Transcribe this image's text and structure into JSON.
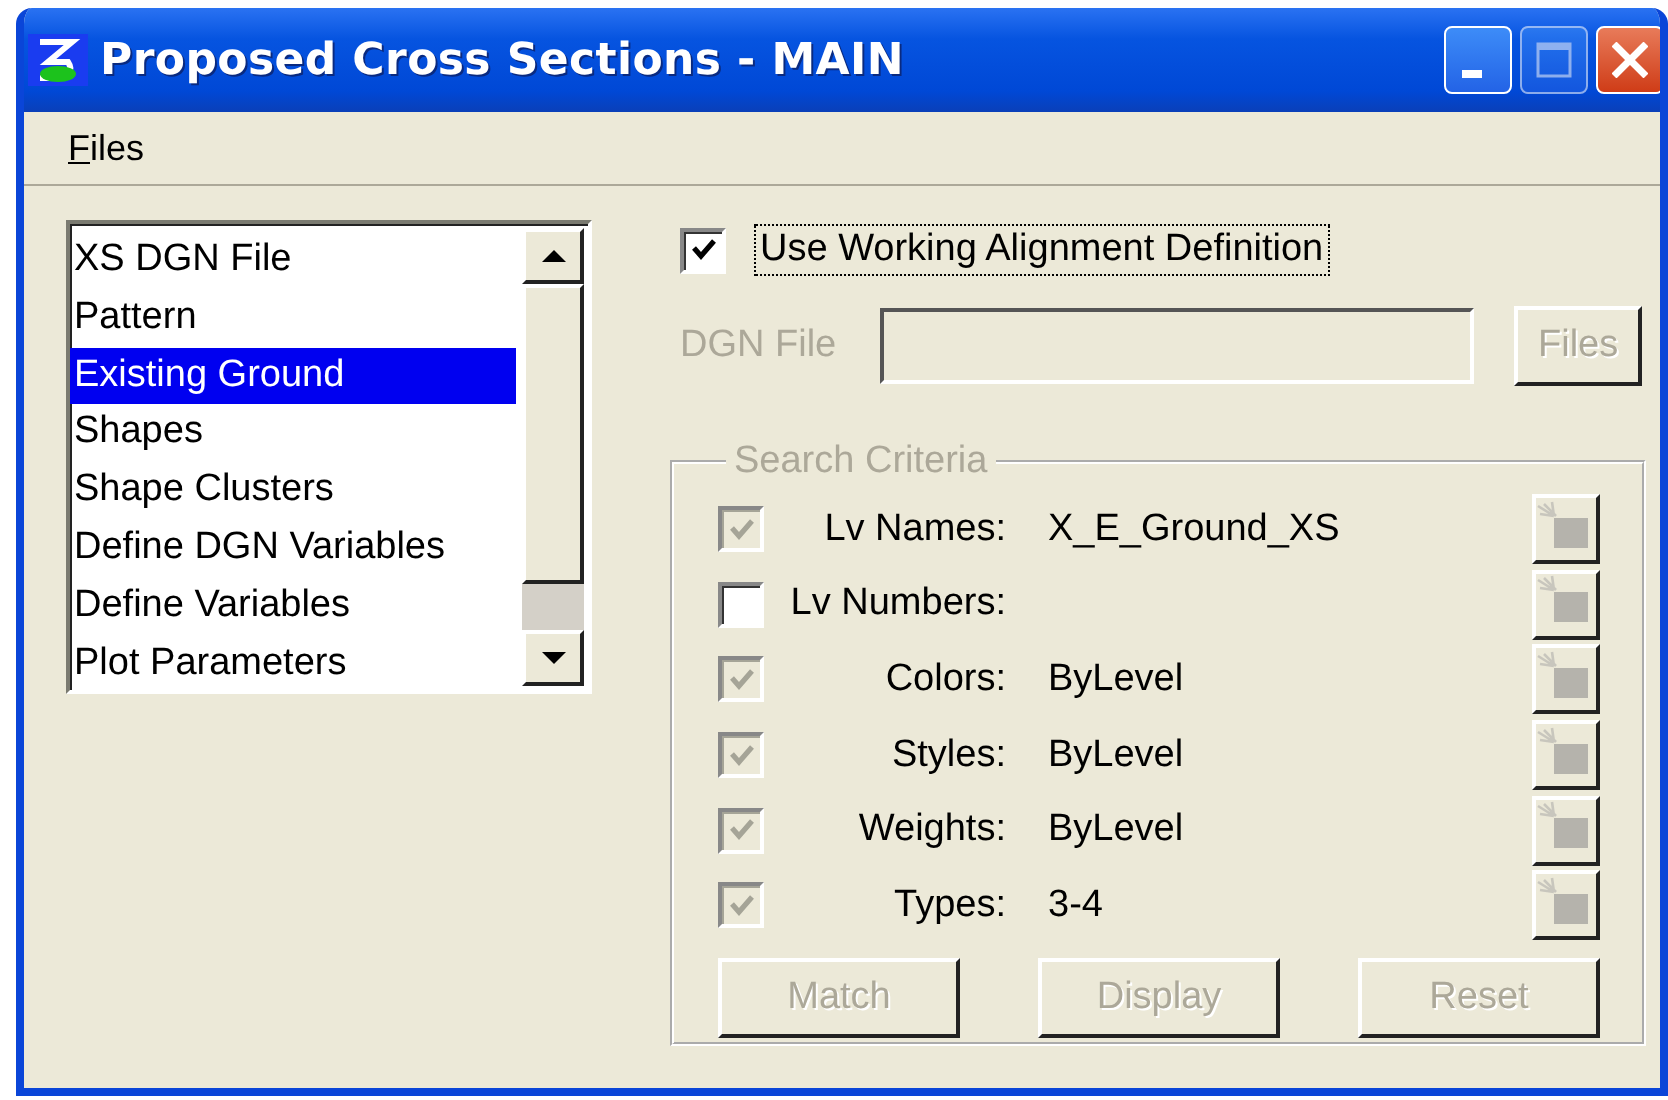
{
  "window": {
    "title": "Proposed Cross Sections - MAIN",
    "controls": [
      {
        "kind": "minimize",
        "disabled": false
      },
      {
        "kind": "maximize",
        "disabled": true
      },
      {
        "kind": "close",
        "disabled": false
      }
    ]
  },
  "menu": [
    {
      "label": "Files"
    }
  ],
  "list": {
    "items": [
      {
        "label": "XS DGN File",
        "selected": false
      },
      {
        "label": "Pattern",
        "selected": false
      },
      {
        "label": "Existing Ground",
        "selected": true
      },
      {
        "label": "Shapes",
        "selected": false
      },
      {
        "label": "Shape Clusters",
        "selected": false
      },
      {
        "label": "Define DGN Variables",
        "selected": false
      },
      {
        "label": "Define Variables",
        "selected": false
      },
      {
        "label": "Plot Parameters",
        "selected": false
      }
    ]
  },
  "use_working_alignment": {
    "label": "Use Working Alignment Definition",
    "checked": true
  },
  "dgn_file": {
    "label": "DGN File",
    "disabled": true,
    "button": "Files"
  },
  "search_criteria": {
    "title": "Search Criteria",
    "disabled": true,
    "rows": [
      {
        "label": "Lv Names:",
        "value": "X_E_Ground_XS",
        "checked": true,
        "disabled": true
      },
      {
        "label": "Lv Numbers:",
        "checked": false,
        "disabled": false
      },
      {
        "label": "Colors:",
        "value": "ByLevel",
        "checked": true,
        "disabled": true
      },
      {
        "label": "Styles:",
        "value": "ByLevel",
        "checked": true,
        "disabled": true
      },
      {
        "label": "Weights:",
        "value": "ByLevel",
        "checked": true,
        "disabled": true
      },
      {
        "label": "Types:",
        "value": "3-4",
        "checked": true,
        "disabled": true
      }
    ],
    "buttons": [
      {
        "label": "Match",
        "disabled": true
      },
      {
        "label": "Display",
        "disabled": true
      },
      {
        "label": "Reset",
        "disabled": true
      }
    ]
  }
}
